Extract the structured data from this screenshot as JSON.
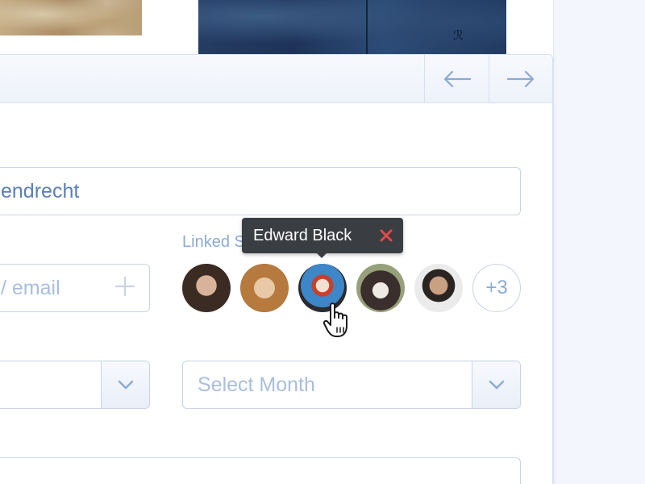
{
  "header": {
    "prev_icon": "arrow-left-icon",
    "next_icon": "arrow-right-icon"
  },
  "form": {
    "location_value": "endrecht",
    "email_placeholder": "/ email",
    "add_icon": "plus-icon",
    "linked_students_label": "Linked Students",
    "more_count": "+3",
    "month_placeholder": "Select Month",
    "chevron_icon": "chevron-down-icon"
  },
  "tooltip": {
    "name": "Edward Black",
    "close_icon": "close-icon"
  },
  "students": [
    {
      "avatar": "avatar-student-1"
    },
    {
      "avatar": "avatar-student-2"
    },
    {
      "avatar": "avatar-edward-black"
    },
    {
      "avatar": "avatar-student-4"
    },
    {
      "avatar": "avatar-student-5"
    }
  ],
  "colors": {
    "accent": "#5a7fb8",
    "placeholder": "#a9bedd",
    "border": "#c7d3e6",
    "tooltip_bg": "#3a3d42",
    "close_red": "#e04b4b"
  }
}
